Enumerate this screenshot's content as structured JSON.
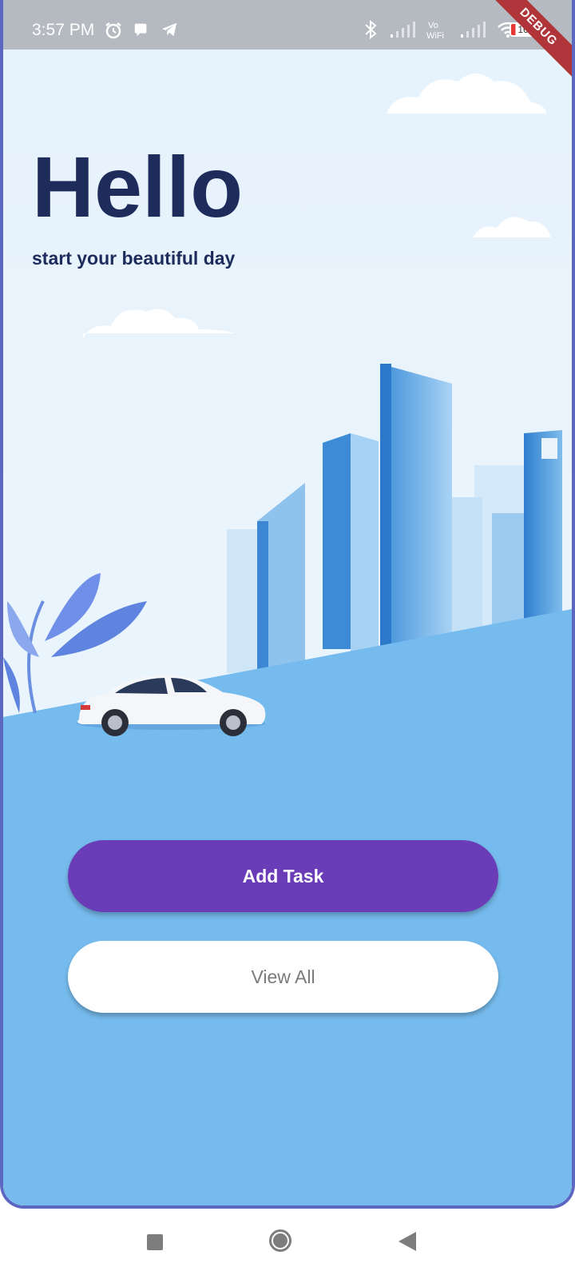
{
  "status_bar": {
    "time": "3:57 PM",
    "battery": "16",
    "icons": [
      "alarm-icon",
      "chat-icon",
      "telegram-icon",
      "bluetooth-icon",
      "signal-icon",
      "vowifi-icon",
      "signal-icon",
      "wifi-icon",
      "battery-icon"
    ]
  },
  "debug_banner": "DEBUG",
  "greeting": {
    "title": "Hello",
    "subtitle": "start your beautiful day"
  },
  "actions": {
    "add_task": "Add Task",
    "view_all": "View All"
  },
  "colors": {
    "sky": "#e8f3fc",
    "ground": "#76bbed",
    "primary_button": "#6a3cb8",
    "title_text": "#1e2c5c",
    "frame": "#5b67c0"
  },
  "nav_bar": {
    "icons": [
      "recent-apps-icon",
      "home-icon",
      "back-icon"
    ]
  }
}
